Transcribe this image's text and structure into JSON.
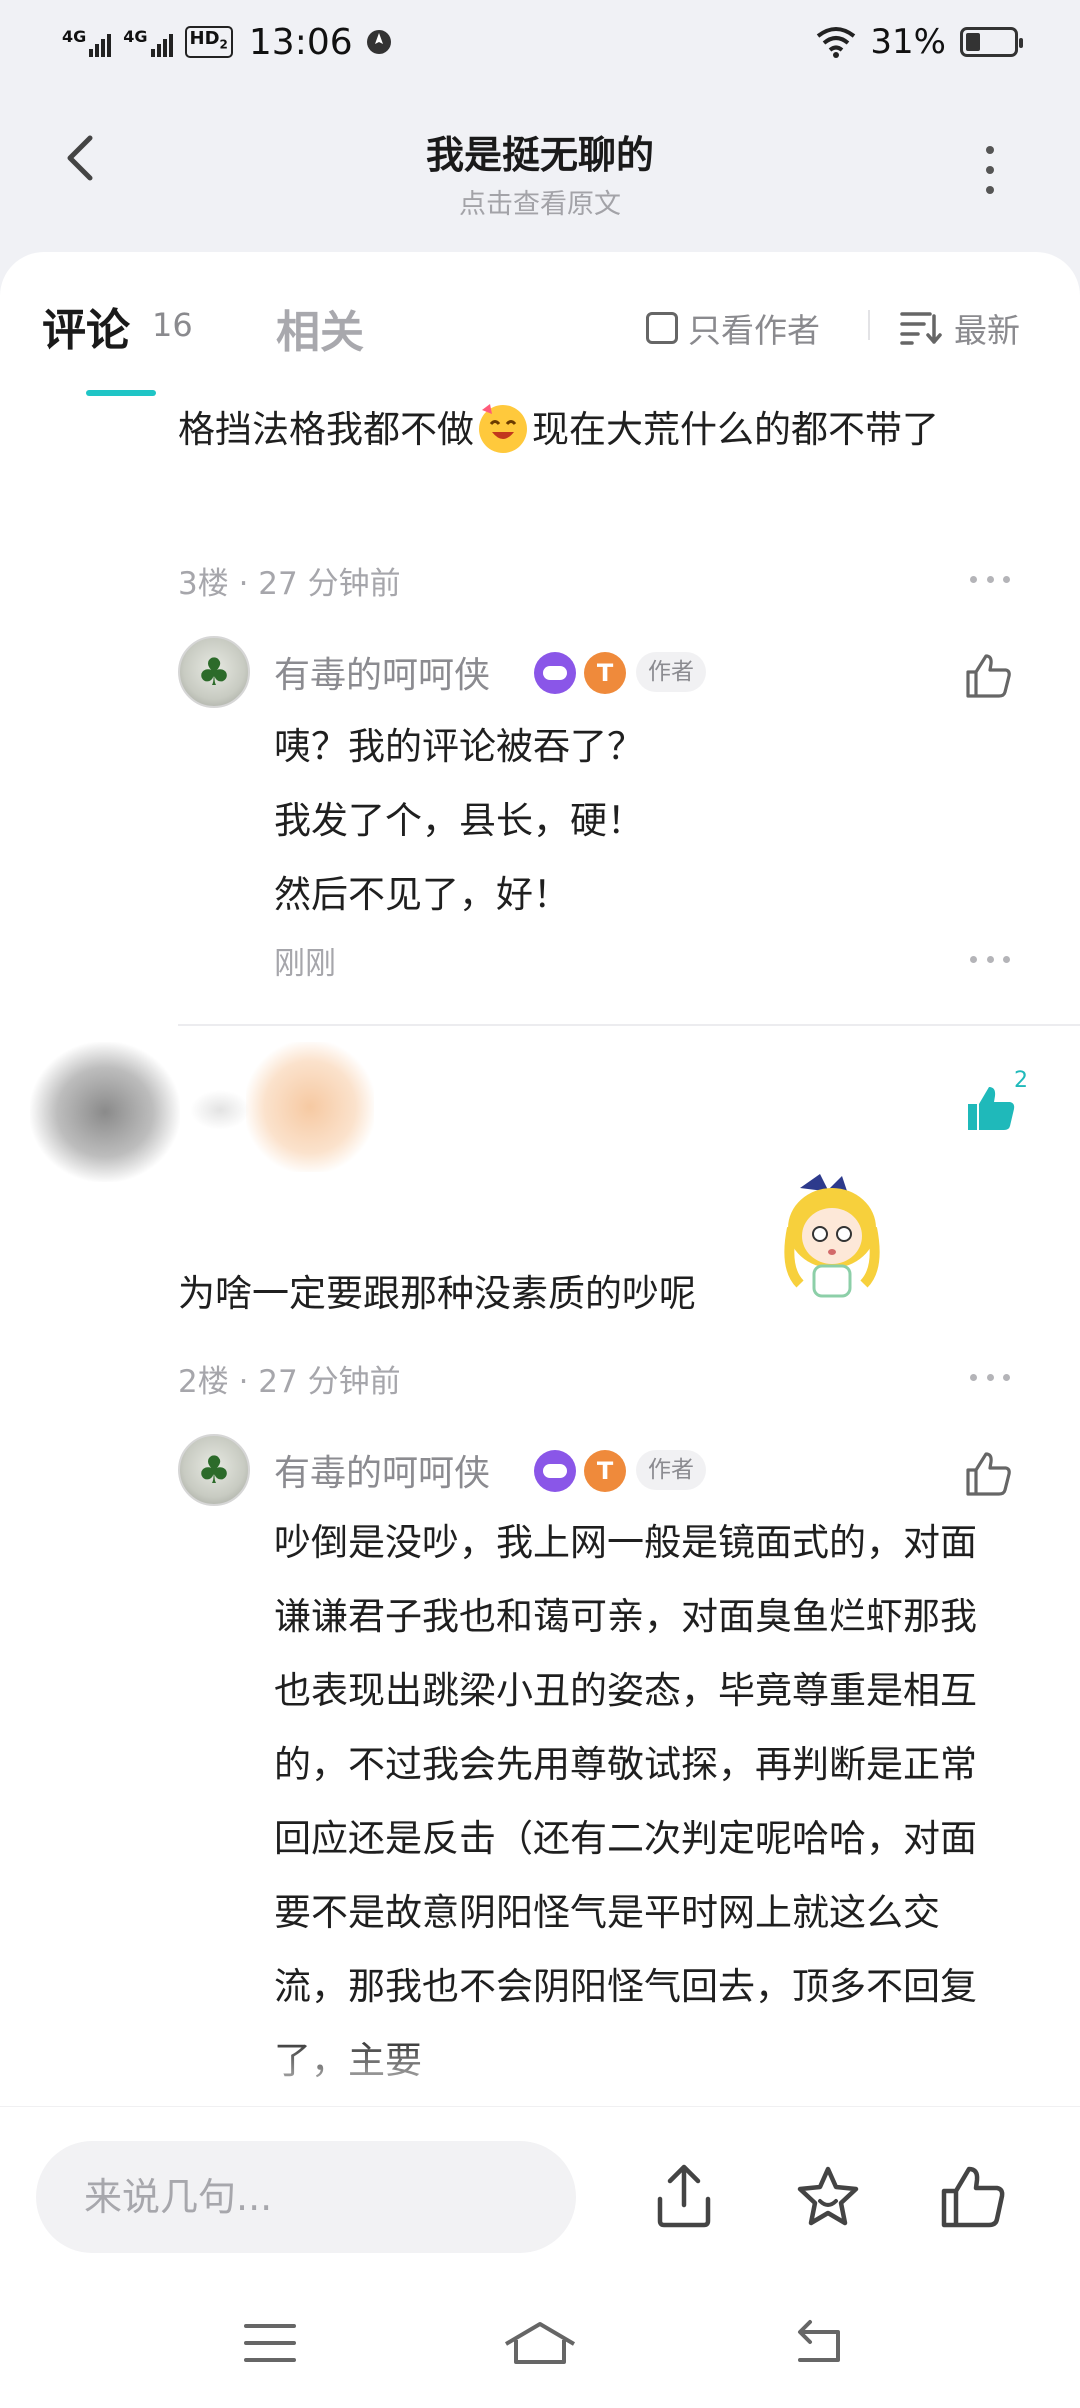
{
  "status_bar": {
    "signal1_label": "4G",
    "signal2_label": "4G",
    "hd_label": "HD",
    "hd_sub": "2",
    "time": "13:06",
    "battery_percent": "31%",
    "battery_level": 0.31
  },
  "header": {
    "title": "我是挺无聊的",
    "subtitle": "点击查看原文"
  },
  "tabs": {
    "comments_label": "评论",
    "comments_count": "16",
    "related_label": "相关",
    "author_only_label": "只看作者",
    "sort_label": "最新"
  },
  "comments": [
    {
      "text_before_emoji": "格挡法格我都不做",
      "text_after_emoji": "现在大荒什么的都不带了",
      "meta": "3楼 · 27 分钟前",
      "reply": {
        "username": "有毒的呵呵侠",
        "level": "T",
        "author_badge": "作者",
        "lines": [
          "咦？我的评论被吞了？",
          "我发了个，县长，硬！",
          "然后不见了，好！"
        ],
        "time": "刚刚"
      }
    },
    {
      "text": "为啥一定要跟那种没素质的吵呢",
      "like_count": "2",
      "meta": "2楼 · 27 分钟前",
      "reply": {
        "username": "有毒的呵呵侠",
        "level": "T",
        "author_badge": "作者",
        "text": "吵倒是没吵，我上网一般是镜面式的，对面谦谦君子我也和蔼可亲，对面臭鱼烂虾那我也表现出跳梁小丑的姿态，毕竟尊重是相互的，不过我会先用尊敬试探，再判断是正常回应还是反击（还有二次判定呢哈哈，对面要不是故意阴阳怪气是平时网上就这么交流，那我也不会阴阳怪气回去，顶多不回复了，主要"
      }
    }
  ],
  "action_bar": {
    "input_placeholder": "来说几句..."
  },
  "colors": {
    "accent": "#1fc5c6",
    "badge_purple": "#8a56e8",
    "badge_orange": "#ef8a3b"
  }
}
